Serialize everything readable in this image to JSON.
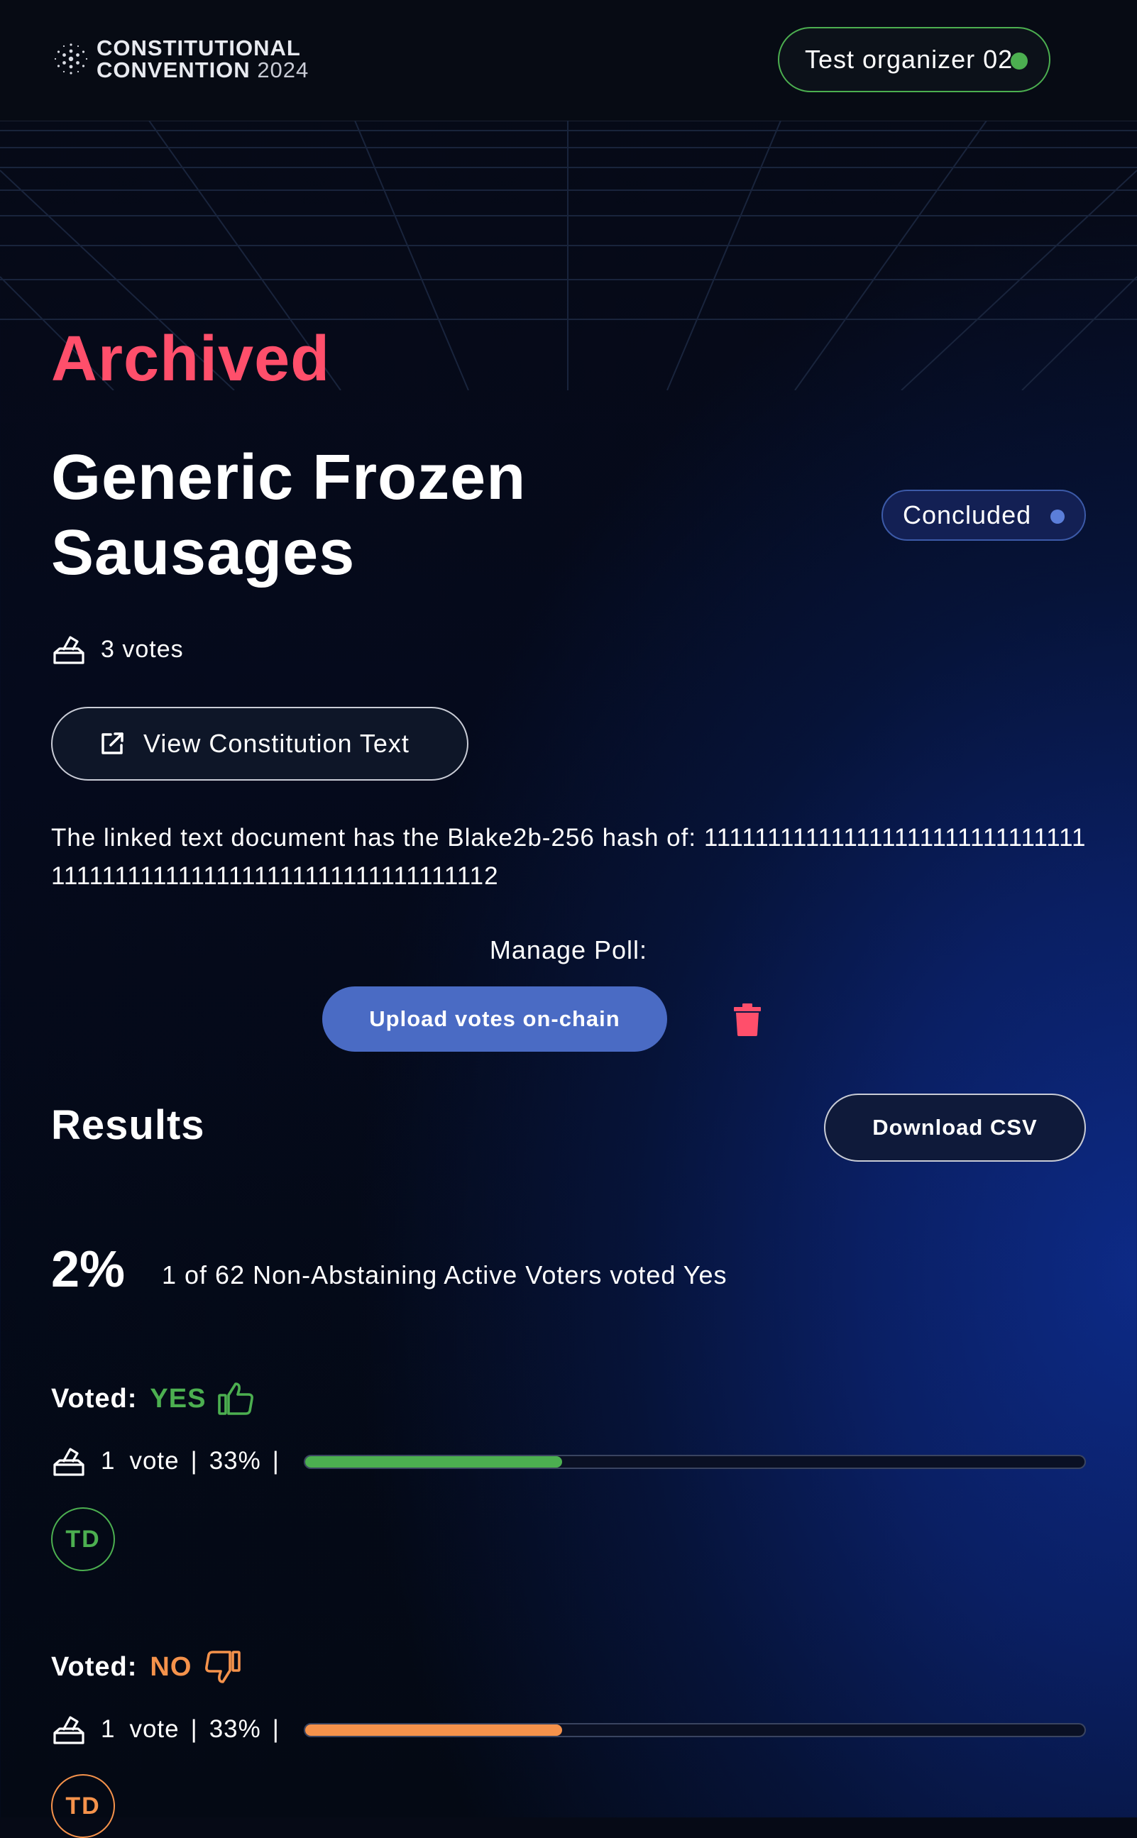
{
  "header": {
    "logo_line1": "CONSTITUTIONAL",
    "logo_line2": "CONVENTION",
    "logo_year": "2024",
    "user_name": "Test organizer 02",
    "user_status_color": "#4caf50"
  },
  "poll": {
    "archived_label": "Archived",
    "title": "Generic Frozen Sausages",
    "status": "Concluded",
    "votes_count": "3 votes",
    "view_button": "View Constitution Text",
    "hash_text": "The linked text document has the Blake2b-256 hash of: 11111111111111111111111111111111111111111111111111111111111111112"
  },
  "manage": {
    "label": "Manage Poll:",
    "upload_button": "Upload votes on-chain",
    "delete_icon": "trash-icon"
  },
  "results": {
    "title": "Results",
    "download_button": "Download CSV",
    "percent": "2%",
    "summary": "1 of 62 Non-Abstaining Active Voters voted Yes",
    "groups": [
      {
        "label": "Voted:",
        "value": "YES",
        "color": "#4caf50",
        "icon": "thumbs-up-icon",
        "count": "1",
        "unit": "vote",
        "percent": "33%",
        "fraction": 0.33,
        "initials": "TD"
      },
      {
        "label": "Voted:",
        "value": "NO",
        "color": "#f5924b",
        "icon": "thumbs-down-icon",
        "count": "1",
        "unit": "vote",
        "percent": "33%",
        "fraction": 0.33,
        "initials": "TD"
      }
    ]
  },
  "colors": {
    "archived": "#ff4f6b",
    "accent": "#4a6bc4",
    "status_dot": "#5b7ed9"
  }
}
